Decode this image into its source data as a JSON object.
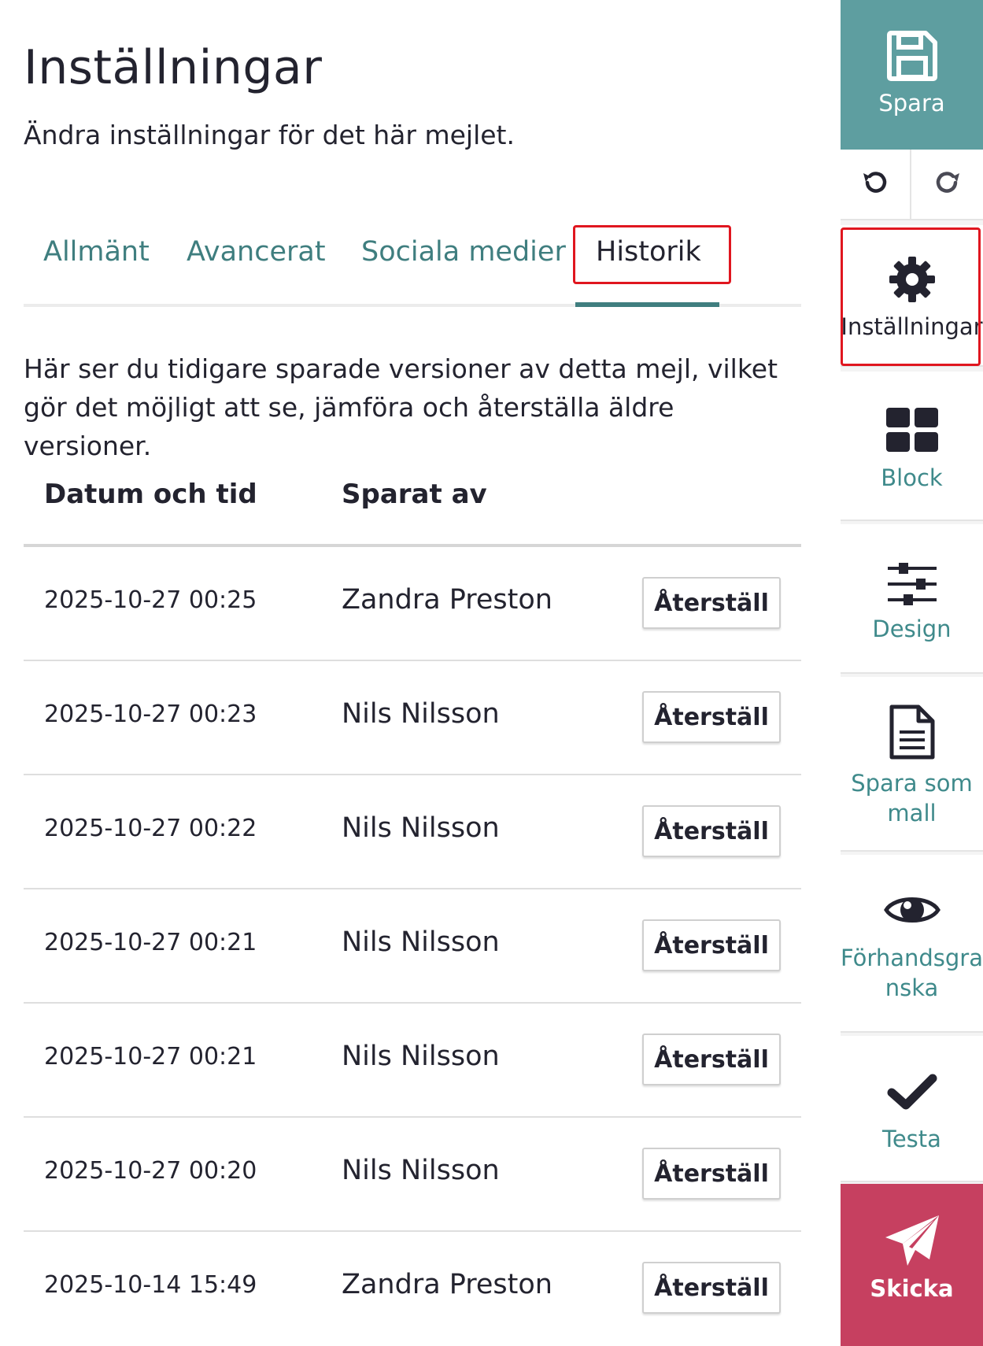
{
  "header": {
    "title": "Inställningar",
    "subtitle": "Ändra inställningar för det här mejlet."
  },
  "tabs": [
    {
      "label": "Allmänt",
      "active": false
    },
    {
      "label": "Avancerat",
      "active": false
    },
    {
      "label": "Sociala medier",
      "active": false
    },
    {
      "label": "Historik",
      "active": true
    }
  ],
  "history": {
    "description": "Här ser du tidigare sparade versioner av detta mejl, vilket gör det möjligt att se, jämföra och återställa äldre versioner.",
    "columns": {
      "date": "Datum och tid",
      "saved_by": "Sparat av"
    },
    "rows": [
      {
        "date": "2025-10-27 00:25",
        "saved_by": "Zandra Preston",
        "action": "Återställ"
      },
      {
        "date": "2025-10-27 00:23",
        "saved_by": "Nils Nilsson",
        "action": "Återställ"
      },
      {
        "date": "2025-10-27 00:22",
        "saved_by": "Nils Nilsson",
        "action": "Återställ"
      },
      {
        "date": "2025-10-27 00:21",
        "saved_by": "Nils Nilsson",
        "action": "Återställ"
      },
      {
        "date": "2025-10-27 00:21",
        "saved_by": "Nils Nilsson",
        "action": "Återställ"
      },
      {
        "date": "2025-10-27 00:20",
        "saved_by": "Nils Nilsson",
        "action": "Återställ"
      },
      {
        "date": "2025-10-14 15:49",
        "saved_by": "Zandra Preston",
        "action": "Återställ"
      }
    ]
  },
  "sidebar": {
    "save": {
      "label": "Spara",
      "icon": "save-icon"
    },
    "undo": {
      "icon": "undo-icon"
    },
    "redo": {
      "icon": "redo-icon"
    },
    "settings": {
      "label": "Inställningar",
      "icon": "gear-icon"
    },
    "block": {
      "label": "Block",
      "icon": "grid-icon"
    },
    "design": {
      "label": "Design",
      "icon": "sliders-icon"
    },
    "template": {
      "label_line1": "Spara som",
      "label_line2": "mall",
      "icon": "document-icon"
    },
    "preview": {
      "label_line1": "Förhandsgra",
      "label_line2": "nska",
      "icon": "eye-icon"
    },
    "test": {
      "label": "Testa",
      "icon": "checkmark-icon"
    },
    "send": {
      "label": "Skicka",
      "icon": "paper-plane-icon"
    }
  },
  "colors": {
    "accent_teal": "#3f7e7f",
    "save_bg": "#5e9ea0",
    "send_bg": "#c64060",
    "highlight_red": "#e0161f",
    "text_dark": "#23232f"
  }
}
